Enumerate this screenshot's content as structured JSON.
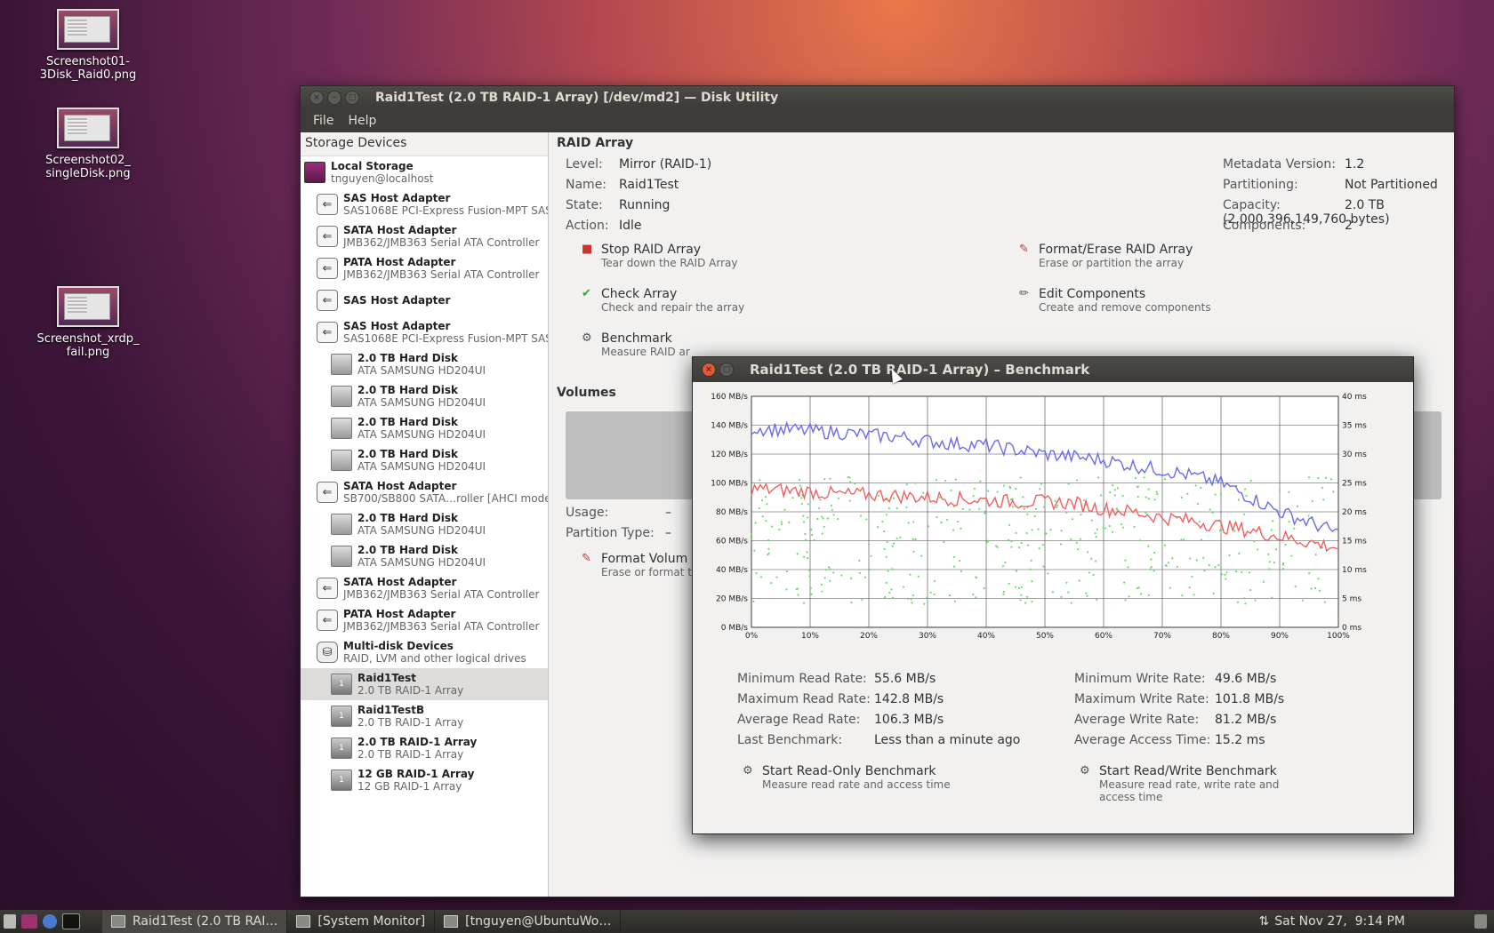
{
  "desktop": {
    "icons": [
      {
        "label": "Screenshot01-\n3Disk_Raid0.png"
      },
      {
        "label": "Screenshot02_\nsingleDisk.png"
      },
      {
        "label": "Screenshot_xrdp_\nfail.png"
      }
    ]
  },
  "window": {
    "title": "Raid1Test (2.0 TB RAID-1 Array) [/dev/md2] — Disk Utility",
    "menu": [
      "File",
      "Help"
    ]
  },
  "sidebar": {
    "header": "Storage Devices",
    "items": [
      {
        "title": "Local Storage",
        "sub": "tnguyen@localhost",
        "icon": "monitor-icon"
      },
      {
        "title": "SAS Host Adapter",
        "sub": "SAS1068E PCI-Express Fusion-MPT SAS",
        "icon": "adapter-icon"
      },
      {
        "title": "SATA Host Adapter",
        "sub": "JMB362/JMB363 Serial ATA Controller",
        "icon": "adapter-icon"
      },
      {
        "title": "PATA Host Adapter",
        "sub": "JMB362/JMB363 Serial ATA Controller",
        "icon": "adapter-icon"
      },
      {
        "title": "SAS Host Adapter",
        "sub": "",
        "icon": "adapter-icon"
      },
      {
        "title": "SAS Host Adapter",
        "sub": "SAS1068E PCI-Express Fusion-MPT SAS",
        "icon": "adapter-icon"
      },
      {
        "title": "2.0 TB Hard Disk",
        "sub": "ATA SAMSUNG HD204UI",
        "icon": "disk-icon"
      },
      {
        "title": "2.0 TB Hard Disk",
        "sub": "ATA SAMSUNG HD204UI",
        "icon": "disk-icon"
      },
      {
        "title": "2.0 TB Hard Disk",
        "sub": "ATA SAMSUNG HD204UI",
        "icon": "disk-icon"
      },
      {
        "title": "2.0 TB Hard Disk",
        "sub": "ATA SAMSUNG HD204UI",
        "icon": "disk-icon"
      },
      {
        "title": "SATA Host Adapter",
        "sub": "SB700/SB800 SATA…roller [AHCI mode]",
        "icon": "adapter-icon"
      },
      {
        "title": "2.0 TB Hard Disk",
        "sub": "ATA SAMSUNG HD204UI",
        "icon": "disk-icon"
      },
      {
        "title": "2.0 TB Hard Disk",
        "sub": "ATA SAMSUNG HD204UI",
        "icon": "disk-icon"
      },
      {
        "title": "SATA Host Adapter",
        "sub": "JMB362/JMB363 Serial ATA Controller",
        "icon": "adapter-icon"
      },
      {
        "title": "PATA Host Adapter",
        "sub": "JMB362/JMB363 Serial ATA Controller",
        "icon": "adapter-icon"
      },
      {
        "title": "Multi-disk Devices",
        "sub": "RAID, LVM and other logical drives",
        "icon": "multidisk-icon"
      },
      {
        "title": "Raid1Test",
        "sub": "2.0 TB RAID-1 Array",
        "icon": "raid-icon"
      },
      {
        "title": "Raid1TestB",
        "sub": "2.0 TB RAID-1 Array",
        "icon": "raid-icon"
      },
      {
        "title": "2.0 TB RAID-1 Array",
        "sub": "2.0 TB RAID-1 Array",
        "icon": "raid-icon"
      },
      {
        "title": "12 GB RAID-1 Array",
        "sub": "12 GB RAID-1 Array",
        "icon": "raid-icon"
      }
    ]
  },
  "raid": {
    "section_title": "RAID Array",
    "level_label": "Level:",
    "level": "Mirror (RAID-1)",
    "name_label": "Name:",
    "name": "Raid1Test",
    "state_label": "State:",
    "state": "Running",
    "action_label": "Action:",
    "action": "Idle",
    "metadata_label": "Metadata Version:",
    "metadata": "1.2",
    "partitioning_label": "Partitioning:",
    "partitioning": "Not Partitioned",
    "capacity_label": "Capacity:",
    "capacity": "2.0 TB (2,000,396,149,760 bytes)",
    "components_label": "Components:",
    "components": "2",
    "actions": {
      "stop": {
        "title": "Stop RAID Array",
        "sub": "Tear down the RAID Array"
      },
      "check": {
        "title": "Check Array",
        "sub": "Check and repair the array"
      },
      "benchmark": {
        "title": "Benchmark",
        "sub": "Measure RAID ar"
      },
      "format": {
        "title": "Format/Erase RAID Array",
        "sub": "Erase or partition the array"
      },
      "edit": {
        "title": "Edit Components",
        "sub": "Create and remove components"
      }
    }
  },
  "volumes": {
    "section_title": "Volumes",
    "usage_label": "Usage:",
    "usage": "–",
    "ptype_label": "Partition Type:",
    "ptype": "–",
    "format": {
      "title": "Format Volum",
      "sub": "Erase or format t"
    }
  },
  "benchmark": {
    "title": "Raid1Test (2.0 TB RAID-1 Array) – Benchmark",
    "min_read_label": "Minimum Read Rate:",
    "min_read": "55.6 MB/s",
    "max_read_label": "Maximum Read Rate:",
    "max_read": "142.8 MB/s",
    "avg_read_label": "Average Read Rate:",
    "avg_read": "106.3 MB/s",
    "last_label": "Last Benchmark:",
    "last": "Less than a minute ago",
    "min_write_label": "Minimum Write Rate:",
    "min_write": "49.6 MB/s",
    "max_write_label": "Maximum Write Rate:",
    "max_write": "101.8 MB/s",
    "avg_write_label": "Average Write Rate:",
    "avg_write": "81.2 MB/s",
    "access_label": "Average Access Time:",
    "access": "15.2 ms",
    "ro_button": {
      "title": "Start Read-Only Benchmark",
      "sub": "Measure read rate and access time"
    },
    "rw_button": {
      "title": "Start Read/Write Benchmark",
      "sub": "Measure read rate, write rate and access time"
    }
  },
  "chart_data": {
    "type": "line",
    "x_ticks": [
      "0%",
      "10%",
      "20%",
      "30%",
      "40%",
      "50%",
      "60%",
      "70%",
      "80%",
      "90%",
      "100%"
    ],
    "y_left_ticks": [
      "0 MB/s",
      "20 MB/s",
      "40 MB/s",
      "60 MB/s",
      "80 MB/s",
      "100 MB/s",
      "120 MB/s",
      "140 MB/s",
      "160 MB/s"
    ],
    "y_right_ticks": [
      "0 ms",
      "5 ms",
      "10 ms",
      "15 ms",
      "20 ms",
      "25 ms",
      "30 ms",
      "35 ms",
      "40 ms"
    ],
    "ylim": [
      0,
      160
    ],
    "y2lim": [
      0,
      40
    ],
    "series": [
      {
        "color": "#6a6af0",
        "x": [
          0,
          5,
          10,
          15,
          20,
          25,
          30,
          35,
          40,
          45,
          50,
          55,
          60,
          65,
          70,
          75,
          80,
          85,
          90,
          95,
          100
        ],
        "values": [
          138,
          137,
          136,
          135,
          133,
          132,
          129,
          127,
          126,
          123,
          120,
          118,
          116,
          112,
          109,
          105,
          100,
          90,
          80,
          73,
          65
        ]
      },
      {
        "color": "#f06060",
        "x": [
          0,
          5,
          10,
          15,
          20,
          25,
          30,
          35,
          40,
          45,
          50,
          55,
          60,
          65,
          70,
          75,
          80,
          85,
          90,
          95,
          100
        ],
        "values": [
          96,
          95,
          94,
          92,
          92,
          91,
          90,
          89,
          88,
          87,
          87,
          86,
          82,
          80,
          76,
          74,
          70,
          67,
          63,
          59,
          55
        ]
      }
    ],
    "access_time_color": "#66dd66",
    "grid": true
  },
  "taskbar": {
    "tasks": [
      {
        "label": "Raid1Test (2.0 TB RAI…"
      },
      {
        "label": "[System Monitor]"
      },
      {
        "label": "[tnguyen@UbuntuWo…"
      }
    ],
    "clock": "Sat Nov 27,  9:14 PM"
  }
}
